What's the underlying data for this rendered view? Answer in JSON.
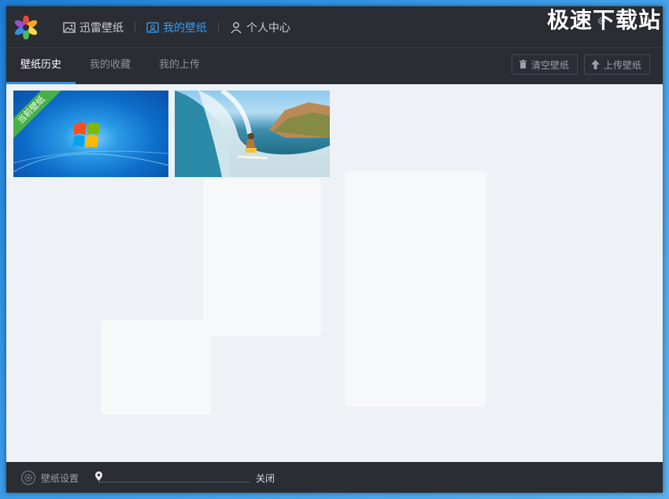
{
  "app": {
    "logo_icon": "colorful-flower-logo"
  },
  "topnav": {
    "items": [
      {
        "label": "迅雷壁纸",
        "icon": "image-icon"
      },
      {
        "label": "我的壁纸",
        "icon": "my-wallpaper-icon",
        "active": true
      },
      {
        "label": "个人中心",
        "icon": "user-icon"
      }
    ]
  },
  "window_controls": [
    "feedback-icon",
    "gear-icon",
    "minimize-icon",
    "close-icon"
  ],
  "tabs": [
    {
      "label": "壁纸历史",
      "active": true
    },
    {
      "label": "我的收藏"
    },
    {
      "label": "我的上传"
    }
  ],
  "actions": {
    "clear_label": "清空壁纸",
    "upload_label": "上传壁纸"
  },
  "thumbnails": [
    {
      "ribbon": "当前壁纸",
      "scene": "windows-7-wallpaper"
    },
    {
      "scene": "surfer-wave-wallpaper"
    }
  ],
  "statusbar": {
    "settings_label": "壁纸设置",
    "slider_end_label": "关闭",
    "slider_level": 0
  },
  "watermark": "极速下载站",
  "colors": {
    "accent": "#2f8fe6",
    "ribbon": "#48b04a",
    "chrome": "#2a2d33"
  }
}
